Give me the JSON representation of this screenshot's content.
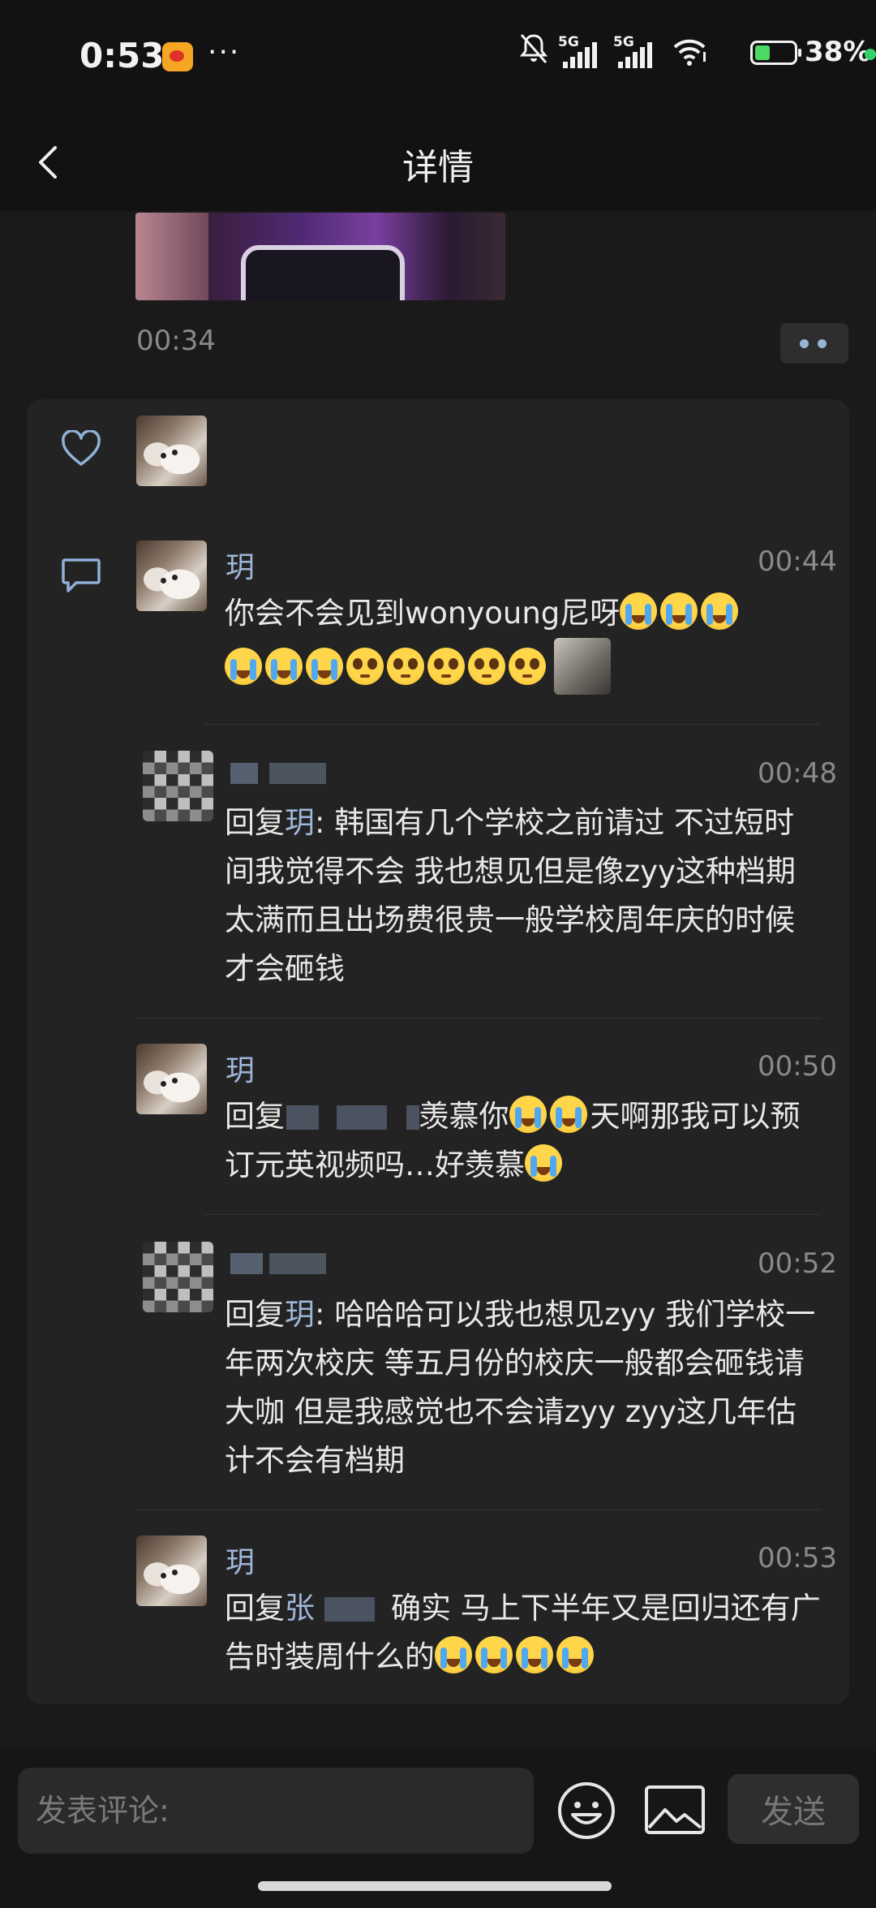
{
  "status_bar": {
    "time": "0:53",
    "dots": "···",
    "battery_pct": "38%",
    "net1": "5G",
    "net2": "5G"
  },
  "header": {
    "title": "详情"
  },
  "post": {
    "time": "00:34"
  },
  "comments": [
    {
      "name": "玥",
      "time": "00:44",
      "text": "你会不会见到wonyoung尼呀"
    },
    {
      "time": "00:48",
      "reply_prefix": "回复",
      "reply_to": "玥",
      "text": ": 韩国有几个学校之前请过 不过短时间我觉得不会 我也想见但是像zyy这种档期太满而且出场费很贵一般学校周年庆的时候才会砸钱"
    },
    {
      "name": "玥",
      "time": "00:50",
      "reply_prefix": "回复",
      "text_a": "羡慕你",
      "text_b": "天啊那我可以预订元英视频吗…好羡慕"
    },
    {
      "time": "00:52",
      "reply_prefix": "回复",
      "reply_to": "玥",
      "text": ": 哈哈哈可以我也想见zyy 我们学校一年两次校庆 等五月份的校庆一般都会砸钱请大咖 但是我感觉也不会请zyy zyy这几年估计不会有档期"
    },
    {
      "name": "玥",
      "time": "00:53",
      "reply_prefix": "回复",
      "reply_to_partial": "张",
      "text": "确实 马上下半年又是回归还有广告时装周什么的"
    }
  ],
  "composer": {
    "placeholder": "发表评论:",
    "send_label": "发送"
  },
  "colors": {
    "accent_name": "#9fb6d8",
    "background": "#1a1a1a",
    "panel": "#232323"
  },
  "icons": {
    "like": "heart-outline-icon",
    "comment": "comment-bubble-icon",
    "emoji": "smiley-icon",
    "image": "image-icon",
    "back": "chevron-left-icon"
  }
}
